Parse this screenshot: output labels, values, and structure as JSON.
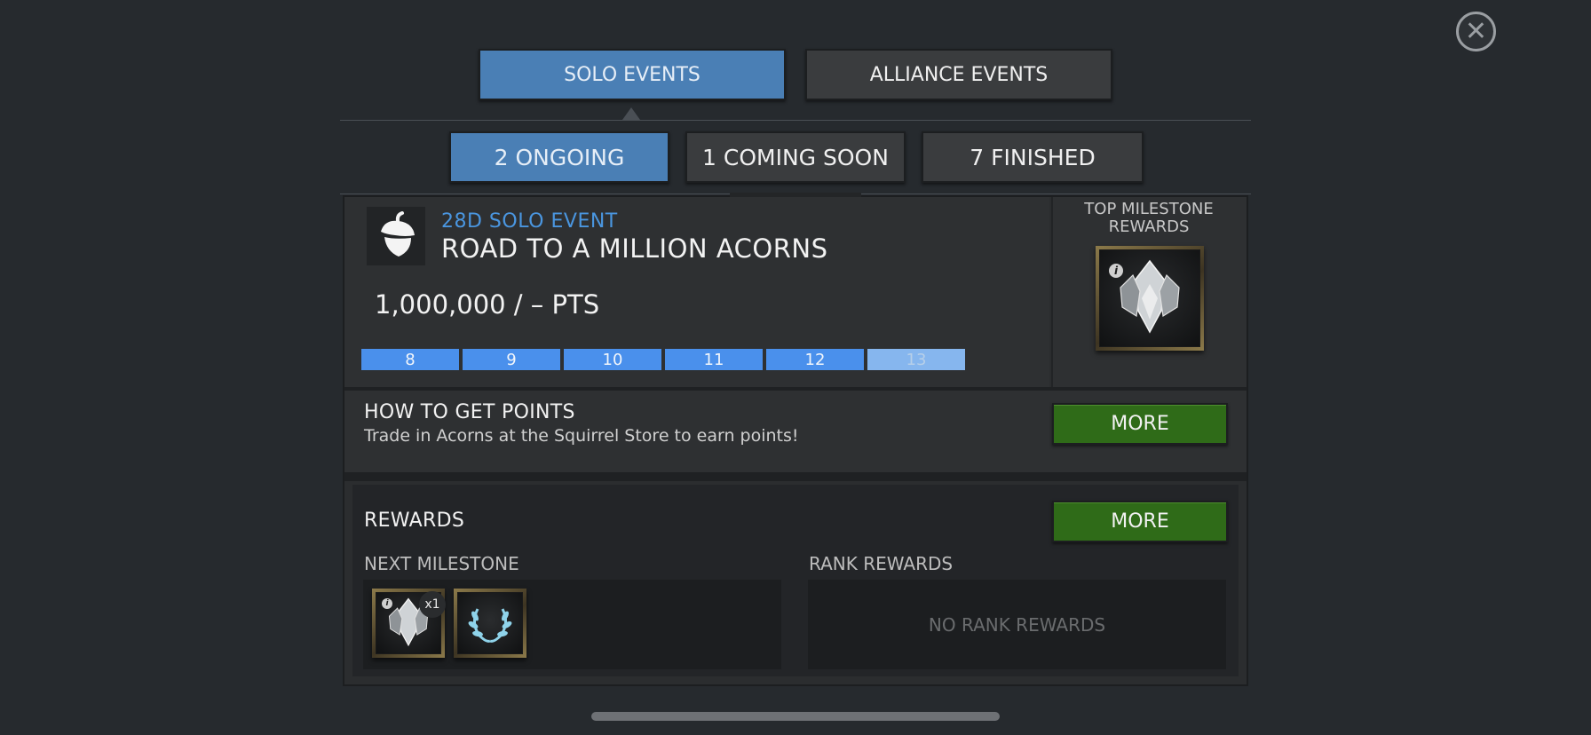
{
  "close": {
    "icon": "close-icon",
    "symbol": "✕"
  },
  "tabs": [
    {
      "label": "SOLO EVENTS",
      "active": true
    },
    {
      "label": "ALLIANCE EVENTS",
      "active": false
    }
  ],
  "subtabs": [
    {
      "label": "2 ONGOING",
      "active": true
    },
    {
      "label": "1 COMING SOON",
      "active": false
    },
    {
      "label": "7 FINISHED",
      "active": false
    }
  ],
  "event": {
    "icon": "acorn-icon",
    "kind": "28D SOLO EVENT",
    "title": "ROAD TO A MILLION ACORNS",
    "points": "1,000,000 / – PTS",
    "milestones": [
      {
        "label": "8",
        "reached": true
      },
      {
        "label": "9",
        "reached": true
      },
      {
        "label": "10",
        "reached": true
      },
      {
        "label": "11",
        "reached": true
      },
      {
        "label": "12",
        "reached": true
      },
      {
        "label": "13",
        "reached": false
      }
    ],
    "top_rewards_label_line1": "TOP MILESTONE",
    "top_rewards_label_line2": "REWARDS",
    "top_reward_icon": "crystal-icon"
  },
  "how_to": {
    "title": "HOW TO GET POINTS",
    "description": "Trade in Acorns at the Squirrel Store to earn points!",
    "button": "MORE"
  },
  "rewards": {
    "title": "REWARDS",
    "button": "MORE",
    "next_milestone_label": "NEXT MILESTONE",
    "rank_rewards_label": "RANK REWARDS",
    "no_rank_rewards": "NO RANK REWARDS",
    "items": [
      {
        "icon": "crystal-icon",
        "quantity": "x1"
      },
      {
        "icon": "laurel-wreath-icon",
        "quantity": ""
      }
    ]
  },
  "colors": {
    "accent_blue": "#4a7fb5",
    "event_kind_blue": "#4a96e0",
    "milestone_blue": "#4a90ec",
    "more_green": "#2f6b18",
    "background": "#262a2e"
  }
}
